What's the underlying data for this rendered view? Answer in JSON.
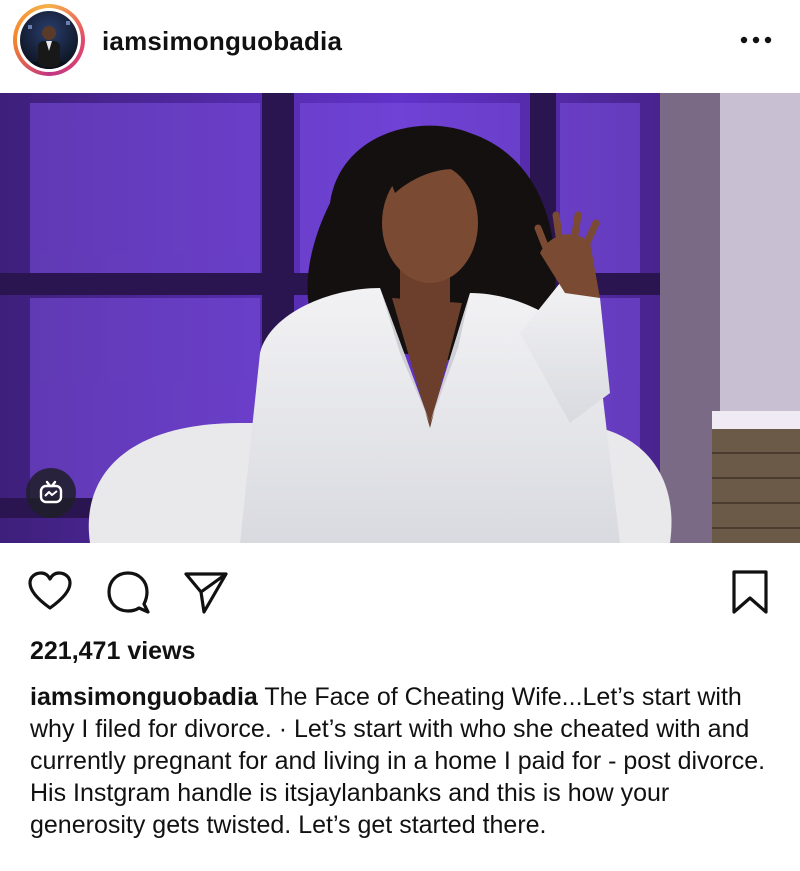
{
  "post": {
    "username": "iamsimonguobadia",
    "views_label": "221,471 views",
    "caption_username": "iamsimonguobadia",
    "caption_text": "The Face of Cheating Wife...Let’s start with why I filed for divorce. · Let’s start with who she cheated with and currently pregnant for and living in a home I paid for - post divorce. His Instgram handle is itsjaylanbanks and this is how your generosity gets twisted. Let’s get started there."
  },
  "icons": {
    "more": "more-options-icon",
    "media_badge": "igtv-icon",
    "like": "heart-icon",
    "comment": "comment-icon",
    "share": "share-icon",
    "save": "bookmark-icon"
  },
  "colors": {
    "text": "#111111",
    "background": "#ffffff",
    "purple_backdrop": "#5a2fb8"
  }
}
